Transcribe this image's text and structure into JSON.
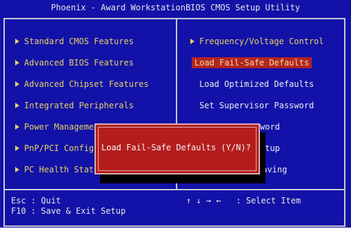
{
  "title": "Phoenix - Award WorkstationBIOS CMOS Setup Utility",
  "left_menu": [
    {
      "label": "Standard CMOS Features"
    },
    {
      "label": "Advanced BIOS Features"
    },
    {
      "label": "Advanced Chipset Features"
    },
    {
      "label": "Integrated Peripherals"
    },
    {
      "label": "Power Management"
    },
    {
      "label": "PnP/PCI Configur"
    },
    {
      "label": "PC Health Status"
    }
  ],
  "right_menu": [
    {
      "label": "Frequency/Voltage Control"
    },
    {
      "label": "Load Fail-Safe Defaults",
      "selected": true
    },
    {
      "label": "Load Optimized Defaults"
    },
    {
      "label": "Set Supervisor Password"
    },
    {
      "label": "word"
    },
    {
      "label": "etup"
    },
    {
      "label": "Saving"
    }
  ],
  "footer": {
    "esc_key": "Esc",
    "esc_action": "Quit",
    "f10_key": "F10",
    "f10_action": "Save & Exit Setup",
    "arrows": "↑ ↓ → ←",
    "arrows_action": "Select Item"
  },
  "dialog": {
    "prompt": "Load Fail-Safe Defaults (Y/N)?"
  },
  "colors": {
    "background": "#1212a8",
    "menu_text": "#e8d060",
    "selection": "#b22424",
    "dialog": "#b51d1d"
  }
}
